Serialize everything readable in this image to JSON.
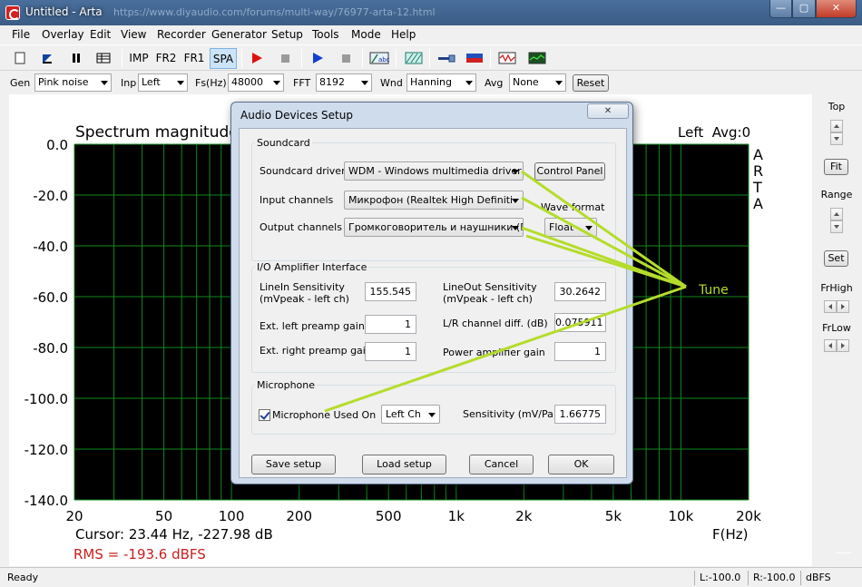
{
  "window": {
    "title": "Untitled - Arta",
    "url": "https://www.diyaudio.com/forums/multi-way/76977-arta-12.html",
    "min": "—",
    "max": "▢",
    "close": "✕"
  },
  "menu": [
    "File",
    "Overlay",
    "Edit",
    "View",
    "Recorder",
    "Generator",
    "Setup",
    "Tools",
    "Mode",
    "Help"
  ],
  "toolbar": {
    "imp": "IMP",
    "fr2": "FR2",
    "fr1": "FR1",
    "spa": "SPA"
  },
  "params": {
    "gen_label": "Gen",
    "gen_value": "Pink noise",
    "inp_label": "Inp",
    "inp_value": "Left",
    "fs_label": "Fs(Hz)",
    "fs_value": "48000",
    "fft_label": "FFT",
    "fft_value": "8192",
    "wnd_label": "Wnd",
    "wnd_value": "Hanning",
    "avg_label": "Avg",
    "avg_value": "None",
    "reset": "Reset"
  },
  "plot": {
    "title": "Spectrum magnitude",
    "channel_info": "Left  Avg:0",
    "brand": [
      "A",
      "R",
      "T",
      "A"
    ],
    "cursor": "Cursor: 23.44 Hz, -227.98 dB",
    "rms": "RMS = -193.6 dBFS",
    "x_axis_label": "F(Hz)"
  },
  "chart_data": {
    "type": "line",
    "title": "Spectrum magnitude",
    "xlabel": "F(Hz)",
    "ylabel": "",
    "xscale": "log",
    "xlim": [
      20,
      20000
    ],
    "ylim": [
      -140,
      0
    ],
    "xticks": [
      20,
      50,
      100,
      200,
      500,
      1000,
      2000,
      5000,
      10000,
      20000
    ],
    "xtick_labels": [
      "20",
      "50",
      "100",
      "200",
      "500",
      "1k",
      "2k",
      "5k",
      "10k",
      "20k"
    ],
    "yticks": [
      0,
      -20,
      -40,
      -60,
      -80,
      -100,
      -120,
      -140
    ],
    "ytick_labels": [
      "0.0",
      "-20.0",
      "-40.0",
      "-60.0",
      "-80.0",
      "-100.0",
      "-120.0",
      "-140.0"
    ],
    "grid": true,
    "series": []
  },
  "right_panel": {
    "top": "Top",
    "fit": "Fit",
    "range": "Range",
    "set": "Set",
    "frhigh": "FrHigh",
    "frlow": "FrLow"
  },
  "status": {
    "ready": "Ready",
    "left": "L:-100.0",
    "right": "R:-100.0",
    "unit": "dBFS"
  },
  "dialog": {
    "title": "Audio Devices Setup",
    "close": "✕",
    "soundcard_group": "Soundcard",
    "soundcard_driver_label": "Soundcard driver",
    "soundcard_driver_value": "WDM - Windows multimedia driver",
    "control_panel": "Control Panel",
    "input_channels_label": "Input channels",
    "input_channels_value": "Микрофон (Realtek High Definiti",
    "output_channels_label": "Output channels",
    "output_channels_value": "Громкоговоритель и наушники (Re",
    "wave_format_label": "Wave format",
    "wave_format_value": "Float",
    "io_group": "I/O Amplifier Interface",
    "linein_label_1": "LineIn Sensitivity",
    "linein_label_2": "(mVpeak - left ch)",
    "linein_value": "155.545",
    "lineout_label_1": "LineOut Sensitivity",
    "lineout_label_2": "(mVpeak - left ch)",
    "lineout_value": "30.2642",
    "ext_left_label": "Ext. left preamp gain",
    "ext_left_value": "1",
    "lr_diff_label": "L/R channel diff. (dB)",
    "lr_diff_value": "0.075911",
    "ext_right_label": "Ext. right preamp gain",
    "ext_right_value": "1",
    "power_amp_label": "Power amplifier gain",
    "power_amp_value": "1",
    "mic_group": "Microphone",
    "mic_used_label": "Microphone Used On",
    "mic_channel_value": "Left Ch",
    "mic_sens_label": "Sensitivity (mV/Pa)",
    "mic_sens_value": "1.66775",
    "save_setup": "Save setup",
    "load_setup": "Load setup",
    "cancel": "Cancel",
    "ok": "OK"
  },
  "annotation": {
    "text": "Tune",
    "color": "#b5dc2b"
  }
}
